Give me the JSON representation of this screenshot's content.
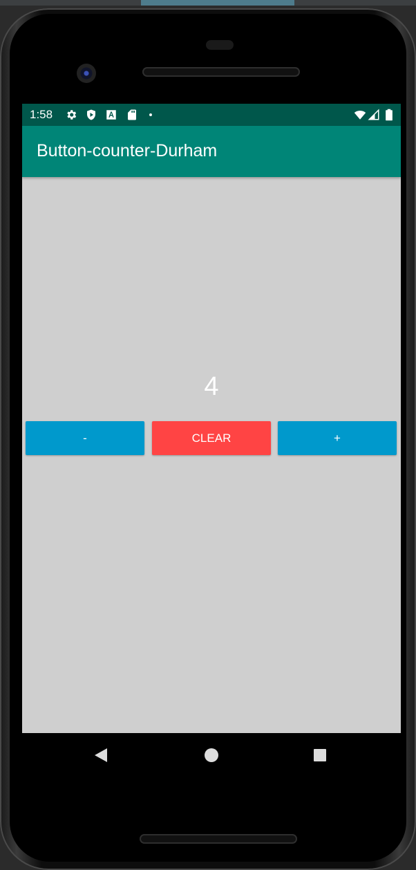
{
  "statusbar": {
    "time": "1:58",
    "left_icons": [
      "settings-gear-icon",
      "shield-play-icon",
      "font-a-icon",
      "sd-card-icon",
      "notification-dot-icon"
    ],
    "right_icons": [
      "wifi-icon",
      "cellular-signal-icon",
      "battery-icon"
    ]
  },
  "appbar": {
    "title": "Button-counter-Durham"
  },
  "main": {
    "counter_value": "4",
    "buttons": {
      "minus_label": "-",
      "clear_label": "CLEAR",
      "plus_label": "+"
    }
  },
  "navbar": {
    "buttons": [
      "back-icon",
      "home-icon",
      "recents-icon"
    ]
  },
  "colors": {
    "statusbar_bg": "#00574b",
    "appbar_bg": "#008577",
    "screen_bg": "#cfcfcf",
    "minus_button": "#0099cc",
    "clear_button": "#ff4444",
    "plus_button": "#0099cc"
  }
}
